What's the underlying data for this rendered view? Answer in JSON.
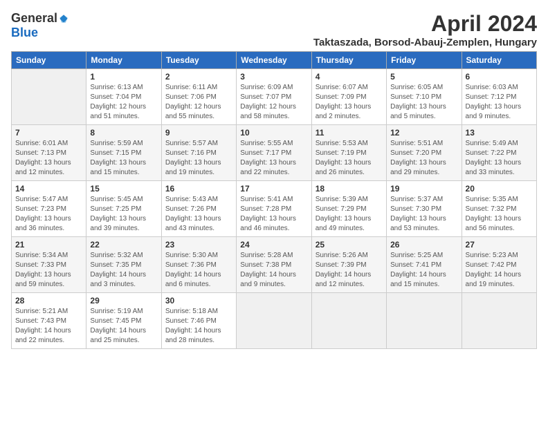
{
  "logo": {
    "general": "General",
    "blue": "Blue"
  },
  "title": {
    "month": "April 2024",
    "location": "Taktaszada, Borsod-Abauj-Zemplen, Hungary"
  },
  "headers": [
    "Sunday",
    "Monday",
    "Tuesday",
    "Wednesday",
    "Thursday",
    "Friday",
    "Saturday"
  ],
  "weeks": [
    [
      {
        "day": "",
        "info": ""
      },
      {
        "day": "1",
        "info": "Sunrise: 6:13 AM\nSunset: 7:04 PM\nDaylight: 12 hours\nand 51 minutes."
      },
      {
        "day": "2",
        "info": "Sunrise: 6:11 AM\nSunset: 7:06 PM\nDaylight: 12 hours\nand 55 minutes."
      },
      {
        "day": "3",
        "info": "Sunrise: 6:09 AM\nSunset: 7:07 PM\nDaylight: 12 hours\nand 58 minutes."
      },
      {
        "day": "4",
        "info": "Sunrise: 6:07 AM\nSunset: 7:09 PM\nDaylight: 13 hours\nand 2 minutes."
      },
      {
        "day": "5",
        "info": "Sunrise: 6:05 AM\nSunset: 7:10 PM\nDaylight: 13 hours\nand 5 minutes."
      },
      {
        "day": "6",
        "info": "Sunrise: 6:03 AM\nSunset: 7:12 PM\nDaylight: 13 hours\nand 9 minutes."
      }
    ],
    [
      {
        "day": "7",
        "info": "Sunrise: 6:01 AM\nSunset: 7:13 PM\nDaylight: 13 hours\nand 12 minutes."
      },
      {
        "day": "8",
        "info": "Sunrise: 5:59 AM\nSunset: 7:15 PM\nDaylight: 13 hours\nand 15 minutes."
      },
      {
        "day": "9",
        "info": "Sunrise: 5:57 AM\nSunset: 7:16 PM\nDaylight: 13 hours\nand 19 minutes."
      },
      {
        "day": "10",
        "info": "Sunrise: 5:55 AM\nSunset: 7:17 PM\nDaylight: 13 hours\nand 22 minutes."
      },
      {
        "day": "11",
        "info": "Sunrise: 5:53 AM\nSunset: 7:19 PM\nDaylight: 13 hours\nand 26 minutes."
      },
      {
        "day": "12",
        "info": "Sunrise: 5:51 AM\nSunset: 7:20 PM\nDaylight: 13 hours\nand 29 minutes."
      },
      {
        "day": "13",
        "info": "Sunrise: 5:49 AM\nSunset: 7:22 PM\nDaylight: 13 hours\nand 33 minutes."
      }
    ],
    [
      {
        "day": "14",
        "info": "Sunrise: 5:47 AM\nSunset: 7:23 PM\nDaylight: 13 hours\nand 36 minutes."
      },
      {
        "day": "15",
        "info": "Sunrise: 5:45 AM\nSunset: 7:25 PM\nDaylight: 13 hours\nand 39 minutes."
      },
      {
        "day": "16",
        "info": "Sunrise: 5:43 AM\nSunset: 7:26 PM\nDaylight: 13 hours\nand 43 minutes."
      },
      {
        "day": "17",
        "info": "Sunrise: 5:41 AM\nSunset: 7:28 PM\nDaylight: 13 hours\nand 46 minutes."
      },
      {
        "day": "18",
        "info": "Sunrise: 5:39 AM\nSunset: 7:29 PM\nDaylight: 13 hours\nand 49 minutes."
      },
      {
        "day": "19",
        "info": "Sunrise: 5:37 AM\nSunset: 7:30 PM\nDaylight: 13 hours\nand 53 minutes."
      },
      {
        "day": "20",
        "info": "Sunrise: 5:35 AM\nSunset: 7:32 PM\nDaylight: 13 hours\nand 56 minutes."
      }
    ],
    [
      {
        "day": "21",
        "info": "Sunrise: 5:34 AM\nSunset: 7:33 PM\nDaylight: 13 hours\nand 59 minutes."
      },
      {
        "day": "22",
        "info": "Sunrise: 5:32 AM\nSunset: 7:35 PM\nDaylight: 14 hours\nand 3 minutes."
      },
      {
        "day": "23",
        "info": "Sunrise: 5:30 AM\nSunset: 7:36 PM\nDaylight: 14 hours\nand 6 minutes."
      },
      {
        "day": "24",
        "info": "Sunrise: 5:28 AM\nSunset: 7:38 PM\nDaylight: 14 hours\nand 9 minutes."
      },
      {
        "day": "25",
        "info": "Sunrise: 5:26 AM\nSunset: 7:39 PM\nDaylight: 14 hours\nand 12 minutes."
      },
      {
        "day": "26",
        "info": "Sunrise: 5:25 AM\nSunset: 7:41 PM\nDaylight: 14 hours\nand 15 minutes."
      },
      {
        "day": "27",
        "info": "Sunrise: 5:23 AM\nSunset: 7:42 PM\nDaylight: 14 hours\nand 19 minutes."
      }
    ],
    [
      {
        "day": "28",
        "info": "Sunrise: 5:21 AM\nSunset: 7:43 PM\nDaylight: 14 hours\nand 22 minutes."
      },
      {
        "day": "29",
        "info": "Sunrise: 5:19 AM\nSunset: 7:45 PM\nDaylight: 14 hours\nand 25 minutes."
      },
      {
        "day": "30",
        "info": "Sunrise: 5:18 AM\nSunset: 7:46 PM\nDaylight: 14 hours\nand 28 minutes."
      },
      {
        "day": "",
        "info": ""
      },
      {
        "day": "",
        "info": ""
      },
      {
        "day": "",
        "info": ""
      },
      {
        "day": "",
        "info": ""
      }
    ]
  ]
}
